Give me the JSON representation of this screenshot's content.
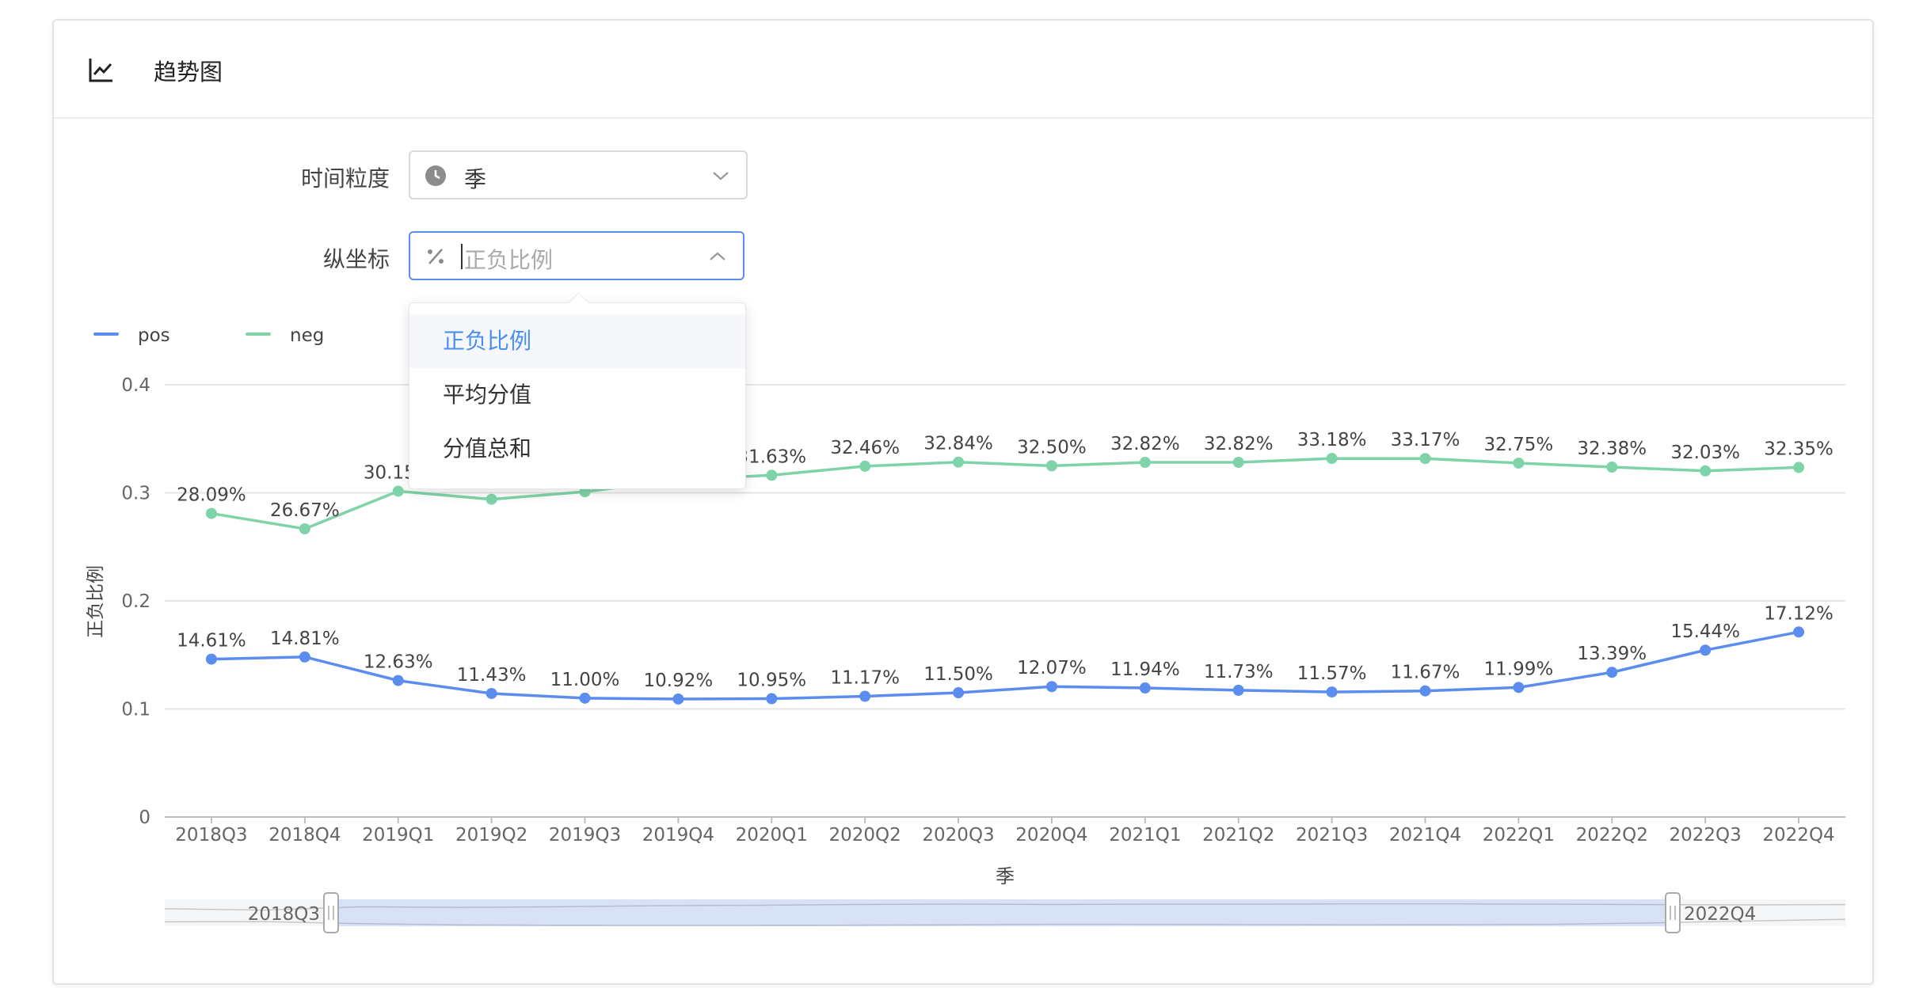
{
  "header": {
    "title": "趋势图",
    "icon": "line-chart-icon"
  },
  "form": {
    "time_granularity": {
      "label": "时间粒度",
      "value": "季",
      "icon": "clock-icon"
    },
    "y_axis": {
      "label": "纵坐标",
      "placeholder": "正负比例",
      "icon": "percent-icon"
    }
  },
  "dropdown": {
    "options": [
      "正负比例",
      "平均分值",
      "分值总和"
    ],
    "active_index": 0
  },
  "colors": {
    "pos": "#5b8def",
    "neg": "#7fd3a8",
    "accent": "#4a8ff0"
  },
  "chart_data": {
    "type": "line",
    "xlabel": "季",
    "ylabel": "正负比例",
    "ylim": [
      0,
      0.4
    ],
    "yticks": [
      "0",
      "0.1",
      "0.2",
      "0.3",
      "0.4"
    ],
    "grid": true,
    "legend": "top-left",
    "categories": [
      "2018Q3",
      "2018Q4",
      "2019Q1",
      "2019Q2",
      "2019Q3",
      "2019Q4",
      "2020Q1",
      "2020Q2",
      "2020Q3",
      "2020Q4",
      "2021Q1",
      "2021Q2",
      "2021Q3",
      "2021Q4",
      "2022Q1",
      "2022Q2",
      "2022Q3",
      "2022Q4"
    ],
    "series": [
      {
        "name": "pos",
        "values": [
          0.1461,
          0.1481,
          0.1263,
          0.1143,
          0.11,
          0.1092,
          0.1095,
          0.1117,
          0.115,
          0.1207,
          0.1194,
          0.1173,
          0.1157,
          0.1167,
          0.1199,
          0.1339,
          0.1544,
          0.1712
        ],
        "labels": [
          "14.61%",
          "14.81%",
          "12.63%",
          "11.43%",
          "11.00%",
          "10.92%",
          "10.95%",
          "11.17%",
          "11.50%",
          "12.07%",
          "11.94%",
          "11.73%",
          "11.57%",
          "11.67%",
          "11.99%",
          "13.39%",
          "15.44%",
          "17.12%"
        ]
      },
      {
        "name": "neg",
        "values": [
          0.2809,
          0.2667,
          0.3015,
          0.294,
          0.301,
          0.312,
          0.3163,
          0.3246,
          0.3284,
          0.325,
          0.3282,
          0.3282,
          0.3318,
          0.3317,
          0.3275,
          0.3238,
          0.3203,
          0.3235
        ],
        "labels": [
          "28.09%",
          "26.67%",
          "30.15%",
          "",
          "",
          "",
          "31.63%",
          "32.46%",
          "32.84%",
          "32.50%",
          "32.82%",
          "32.82%",
          "33.18%",
          "33.17%",
          "32.75%",
          "32.38%",
          "32.03%",
          "32.35%"
        ]
      }
    ],
    "zoom": {
      "start": "2018Q3",
      "end": "2022Q4"
    }
  }
}
